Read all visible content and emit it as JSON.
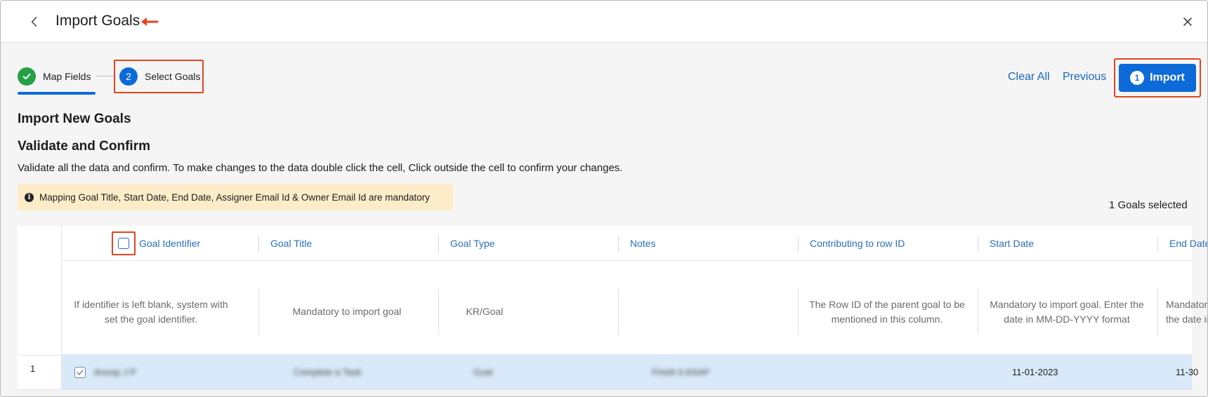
{
  "header": {
    "title": "Import Goals"
  },
  "stepper": {
    "steps": [
      {
        "number": "1",
        "label": "Map Fields",
        "status": "done"
      },
      {
        "number": "2",
        "label": "Select Goals",
        "status": "active"
      }
    ]
  },
  "actions": {
    "clear_all": "Clear All",
    "previous": "Previous",
    "import": "Import",
    "import_badge": "1"
  },
  "content": {
    "heading": "Import New Goals",
    "subheading": "Validate and Confirm",
    "description": "Validate all the data and confirm. To make changes to the data double click the cell, Click outside the cell to confirm your changes.",
    "notice": "Mapping Goal Title, Start Date, End Date, Assigner Email Id & Owner Email Id are mandatory",
    "selected_count": "1 Goals selected"
  },
  "table": {
    "columns": [
      {
        "header": "Goal Identifier",
        "hint": "If identifier is left blank, system with set the goal identifier."
      },
      {
        "header": "Goal Title",
        "hint": "Mandatory to import goal"
      },
      {
        "header": "Goal Type",
        "hint": "KR/Goal"
      },
      {
        "header": "Notes",
        "hint": ""
      },
      {
        "header": "Contributing to row ID",
        "hint": "The Row ID of the parent goal to be mentioned in this column."
      },
      {
        "header": "Start Date",
        "hint": "Mandatory to import goal. Enter the date in MM-DD-YYYY format"
      },
      {
        "header": "End Date",
        "hint": "Mandator the date in"
      }
    ],
    "rows": [
      {
        "row_number": "1",
        "checked": true,
        "cells": [
          "Anoop J P",
          "Complete a Task",
          "Goal",
          "Finish it ASAP",
          "",
          "11-01-2023",
          "11-30"
        ]
      }
    ]
  },
  "colors": {
    "primary": "#0d6ad9",
    "success": "#26a046",
    "link": "#1667c4",
    "notice_bg": "#fdecc8",
    "selected_row_bg": "#d9e9f9",
    "annotation": "#e5421f"
  }
}
